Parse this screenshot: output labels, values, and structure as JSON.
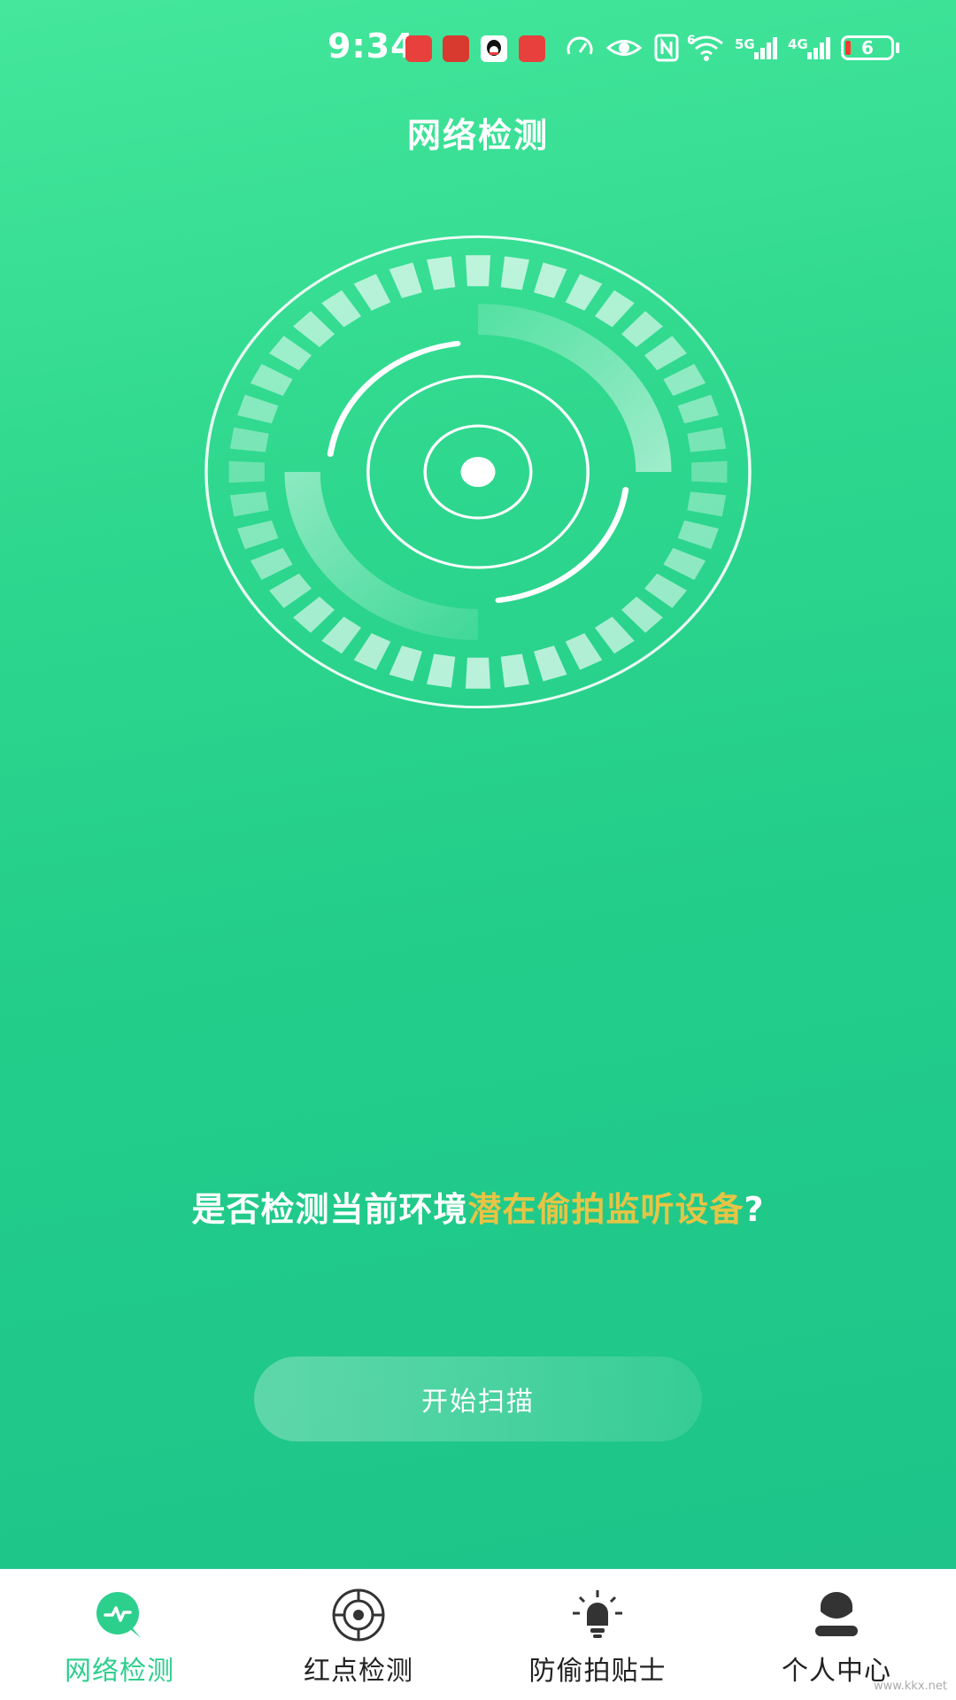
{
  "status_bar": {
    "time": "9:34",
    "battery": "6",
    "network_1": "5G",
    "network_2": "4G",
    "wifi_sub": "6"
  },
  "header": {
    "title": "网络检测"
  },
  "prompt": {
    "lead": "是否检测当前环境",
    "highlight": "潜在偷拍监听设备",
    "tail": "?"
  },
  "scan_button": {
    "label": "开始扫描"
  },
  "bottom_nav": {
    "items": [
      {
        "label": "网络检测",
        "icon": "network-detect-icon",
        "active": true
      },
      {
        "label": "红点检测",
        "icon": "target-icon",
        "active": false
      },
      {
        "label": "防偷拍贴士",
        "icon": "bulb-icon",
        "active": false
      },
      {
        "label": "个人中心",
        "icon": "person-icon",
        "active": false
      }
    ]
  },
  "watermark": "www.kkx.net",
  "colors": {
    "accent": "#2dcf8d",
    "highlight": "#e6c445",
    "background_top": "#44e79c",
    "background_bottom": "#1ec48a"
  }
}
